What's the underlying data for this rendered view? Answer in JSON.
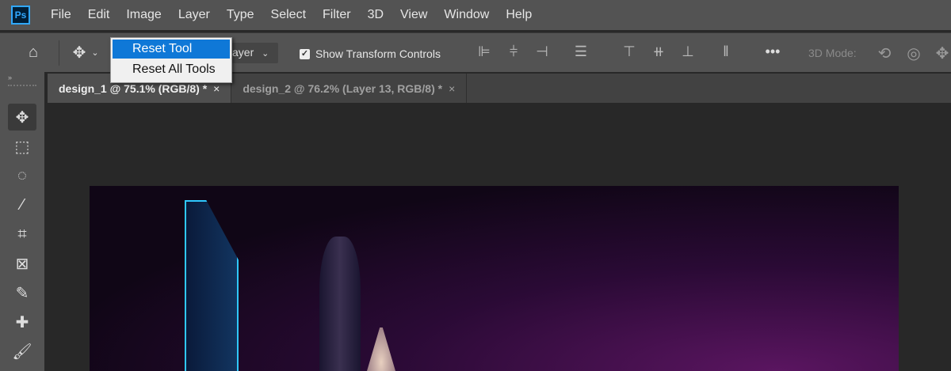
{
  "app": {
    "logo": "Ps"
  },
  "menu": [
    "File",
    "Edit",
    "Image",
    "Layer",
    "Type",
    "Select",
    "Filter",
    "3D",
    "View",
    "Window",
    "Help"
  ],
  "options": {
    "auto_select_value": "ayer",
    "show_transform_label": "Show Transform Controls",
    "show_transform_checked": true,
    "mode_label": "3D Mode:"
  },
  "dropdown": {
    "items": [
      "Reset Tool",
      "Reset All Tools"
    ],
    "highlighted": 0
  },
  "tabs": [
    {
      "label": "design_1 @ 75.1% (RGB/8) *",
      "close": "×",
      "active": true
    },
    {
      "label": "design_2 @ 76.2% (Layer 13, RGB/8) *",
      "close": "×",
      "active": false
    }
  ],
  "tools": [
    "move",
    "rectangular-marquee",
    "lasso",
    "magic-wand",
    "crop",
    "frame",
    "eyedropper",
    "healing-brush",
    "brush"
  ]
}
